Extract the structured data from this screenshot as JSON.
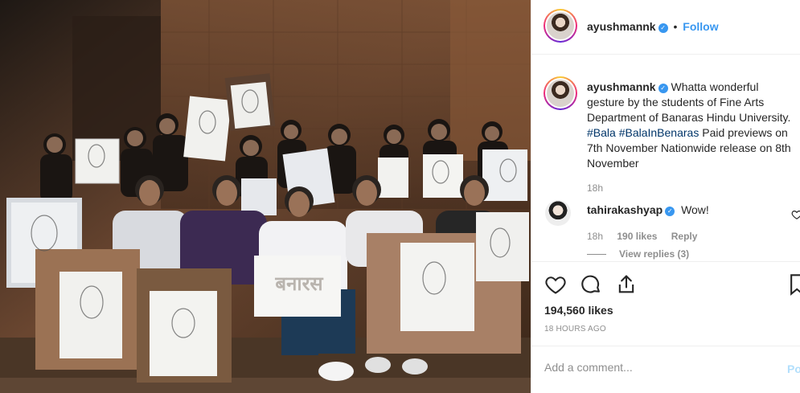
{
  "photo": {
    "sign_text": "बनारस"
  },
  "header": {
    "username": "ayushmannk",
    "separator": "•",
    "follow_label": "Follow",
    "verified_icon": "verified-badge-icon"
  },
  "caption": {
    "username": "ayushmannk",
    "text_1": "Whatta wonderful gesture by the students of Fine Arts Department of Banaras Hindu University.",
    "tag_1": "#Bala",
    "tag_2": "#BalaInBenaras",
    "text_2": "Paid previews on 7th November Nationwide release on 8th November",
    "time": "18h"
  },
  "comment": {
    "username": "tahirakashyap",
    "text": "Wow!",
    "time": "18h",
    "likes": "190 likes",
    "reply_label": "Reply",
    "view_replies": "View replies (3)"
  },
  "actions": {
    "likes_count": "194,560 likes",
    "posted": "18 HOURS AGO",
    "icons": [
      "heart-icon",
      "comment-icon",
      "share-icon",
      "bookmark-icon"
    ]
  },
  "add_comment": {
    "placeholder": "Add a comment...",
    "post_label": "Post"
  },
  "colors": {
    "link": "#3897f0",
    "hashtag": "#003569",
    "muted": "#8e8e8e",
    "border": "#efefef"
  }
}
